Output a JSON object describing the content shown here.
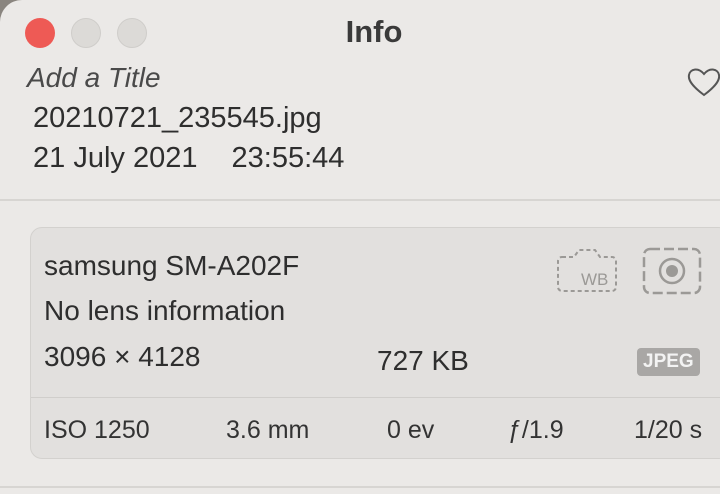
{
  "window": {
    "title": "Info"
  },
  "header": {
    "add_title": "Add a Title",
    "filename": "20210721_235545.jpg",
    "date": "21 July 2021",
    "time": "23:55:44",
    "favorite_icon": "heart-icon"
  },
  "camera": {
    "model": "samsung SM-A202F",
    "lens": "No lens information",
    "dimensions": "3096 × 4128",
    "file_size": "727 KB",
    "format": "JPEG",
    "wb_icon_label": "WB",
    "icons": [
      "white-balance-camera-icon",
      "lens-icon"
    ]
  },
  "exif": {
    "iso": "ISO 1250",
    "focal_length": "3.6 mm",
    "exposure_bias": "0 ev",
    "aperture": "ƒ/1.9",
    "shutter": "1/20 s"
  },
  "colors": {
    "close": "#ee5a55",
    "window_bg": "#ebe9e7",
    "card_bg": "#e2e0de",
    "badge_bg": "#a9a7a5"
  }
}
